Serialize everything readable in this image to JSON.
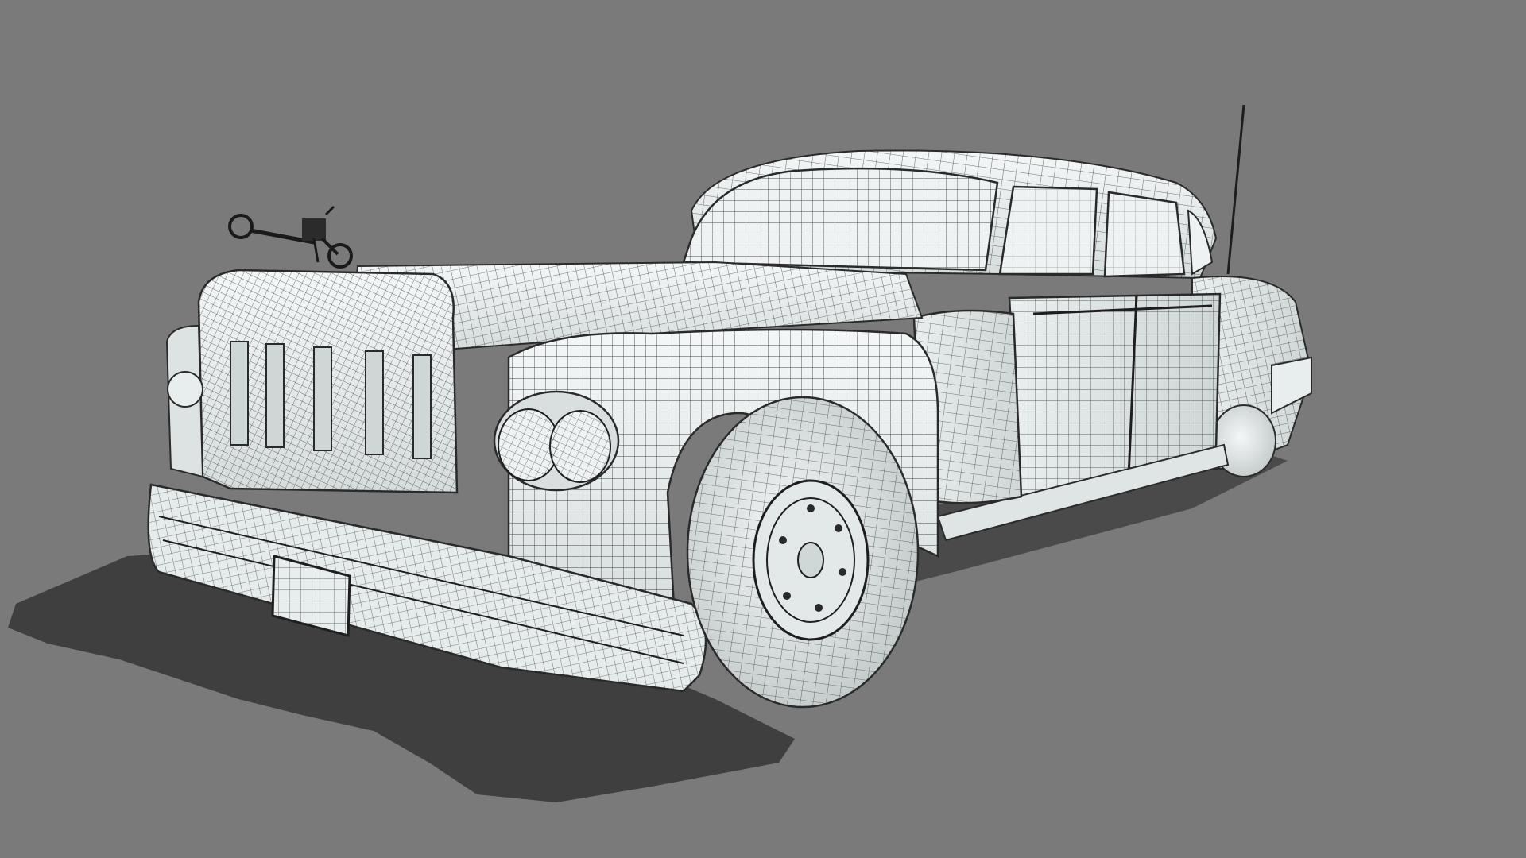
{
  "viewport": {
    "background_color": "#7a7a7a",
    "shadow_color": "#3f3f3f",
    "surface_color": "#f2f5f5",
    "shade_color": "#c7cece",
    "wire_color": "#2a2a2a",
    "wire_light_color": "#5c6060",
    "glass_color": "#eef2f2"
  },
  "model": {
    "subject": "vintage-limousine",
    "render_style": "wireframe-on-shaded",
    "hood_ornament": "motorcycle-figurine",
    "antenna": true
  }
}
